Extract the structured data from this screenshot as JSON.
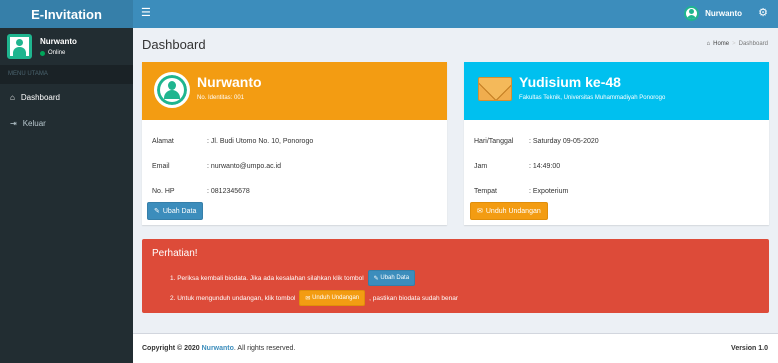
{
  "app": {
    "logo": "E-Invitation"
  },
  "navbar": {
    "menu_icon": "☰",
    "user_name": "Nurwanto",
    "settings_icon": "⚙"
  },
  "sidebar": {
    "user_name": "Nurwanto",
    "status": "Online",
    "section_header": "MENU UTAMA",
    "items": [
      {
        "icon": "⌂",
        "label": "Dashboard"
      },
      {
        "icon": "⇥",
        "label": "Keluar"
      }
    ]
  },
  "page": {
    "title": "Dashboard",
    "breadcrumb": {
      "home": "Home",
      "current": "Dashboard",
      "separator": ">"
    }
  },
  "profile_card": {
    "name": "Nurwanto",
    "identity": "No. Identitas: 001",
    "rows": [
      {
        "key": "Alamat",
        "value": ": Jl. Budi Utomo No. 10, Ponorogo"
      },
      {
        "key": "Email",
        "value": ": nurwanto@umpo.ac.id"
      },
      {
        "key": "No. HP",
        "value": ": 0812345678"
      }
    ],
    "button": "Ubah Data",
    "color": "#f39c12"
  },
  "event_card": {
    "title": "Yudisium ke-48",
    "subtitle": "Fakultas Teknik, Universitas Muhammadiyah Ponorogo",
    "rows": [
      {
        "key": "Hari/Tanggal",
        "value": ": Saturday 09-05-2020"
      },
      {
        "key": "Jam",
        "value": ": 14:49:00"
      },
      {
        "key": "Tempat",
        "value": ": Expoterium"
      }
    ],
    "button": "Unduh Undangan",
    "color": "#00c0ef"
  },
  "alert": {
    "title": "Perhatian!",
    "item1_text": "1. Periksa kembali biodata. Jika ada kesalahan silahkan klik tombol",
    "item1_button": "Ubah Data",
    "item2_text": "2. Untuk mengunduh undangan, klik tombol",
    "item2_button": "Unduh Undangan",
    "item2_suffix": ", pastikan biodata sudah benar",
    "color": "#dd4b39"
  },
  "footer": {
    "copyright": "Copyright © 2020",
    "author": "Nurwanto",
    "rights": ". All rights reserved.",
    "version": "Version 1.0"
  }
}
